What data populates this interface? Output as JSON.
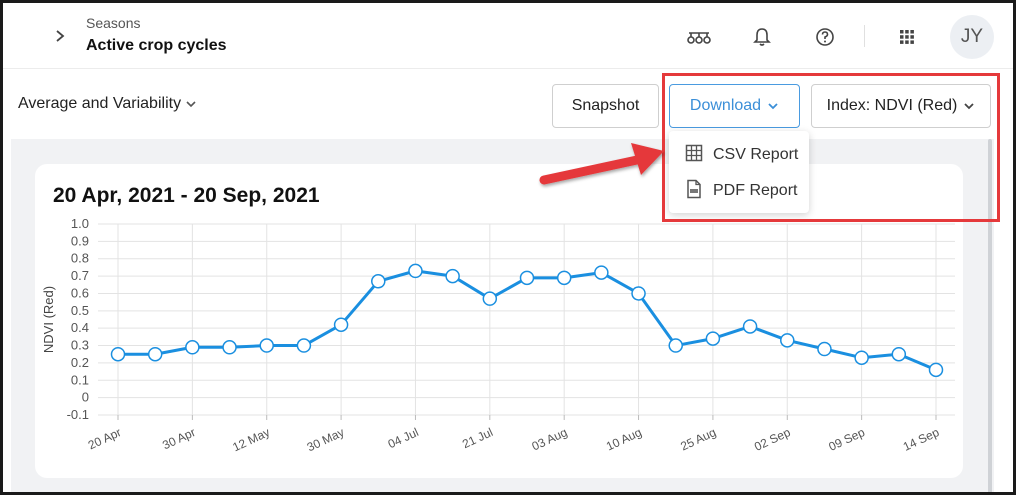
{
  "header": {
    "breadcrumb_parent": "Seasons",
    "title": "Active crop cycles",
    "avatar_initials": "JY",
    "icons": [
      "collapse-chevron-icon",
      "farm-equipment-icon",
      "bell-icon",
      "help-icon",
      "apps-grid-icon"
    ]
  },
  "toolbar": {
    "view_label": "Average and Variability",
    "snapshot_label": "Snapshot",
    "download_label": "Download",
    "index_label": "Index: NDVI (Red)"
  },
  "download_menu": {
    "items": [
      {
        "label": "CSV Report",
        "icon": "table-icon"
      },
      {
        "label": "PDF Report",
        "icon": "pdf-file-icon"
      }
    ]
  },
  "card": {
    "title": "20 Apr, 2021 - 20 Sep, 2021"
  },
  "chart_data": {
    "type": "line",
    "title": "20 Apr, 2021 - 20 Sep, 2021",
    "xlabel": "",
    "ylabel": "NDVI (Red)",
    "ylim": [
      -0.1,
      1.0
    ],
    "y_ticks": [
      "1.0",
      "0.9",
      "0.8",
      "0.7",
      "0.6",
      "0.5",
      "0.4",
      "0.3",
      "0.2",
      "0.1",
      "0",
      "-0.1"
    ],
    "x_tick_labels": [
      "20 Apr",
      "30 Apr",
      "12 May",
      "30 May",
      "04 Jul",
      "21 Jul",
      "03 Aug",
      "10 Aug",
      "25 Aug",
      "02 Sep",
      "09 Sep",
      "14 Sep"
    ],
    "grid": true,
    "series": [
      {
        "values": [
          0.25,
          0.25,
          0.29,
          0.29,
          0.3,
          0.3,
          0.42,
          0.67,
          0.73,
          0.7,
          0.57,
          0.69,
          0.69,
          0.72,
          0.6,
          0.3,
          0.34,
          0.41,
          0.33,
          0.28,
          0.23,
          0.25,
          0.16
        ],
        "color": "#1a8fe0"
      }
    ]
  },
  "colors": {
    "accent": "#3b8fd8",
    "annotation_red": "#e5393b",
    "series_line": "#1a8fe0"
  }
}
